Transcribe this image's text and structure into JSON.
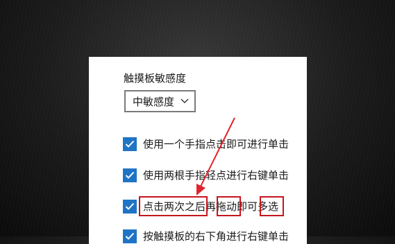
{
  "settings": {
    "sensitivity_label": "触摸板敏感度",
    "sensitivity_value": "中敏感度",
    "checkboxes": [
      {
        "label": "使用一个手指点击即可进行单击",
        "checked": true
      },
      {
        "label": "使用两根手指轻点进行右键单击",
        "checked": true
      },
      {
        "label": "点击两次之后再拖动即可多选",
        "checked": true
      },
      {
        "label": "按触摸板的右下角进行右键单击",
        "checked": true
      }
    ]
  },
  "colors": {
    "checkbox_accent": "#1f74c5",
    "annotation_red": "#c4161c"
  }
}
